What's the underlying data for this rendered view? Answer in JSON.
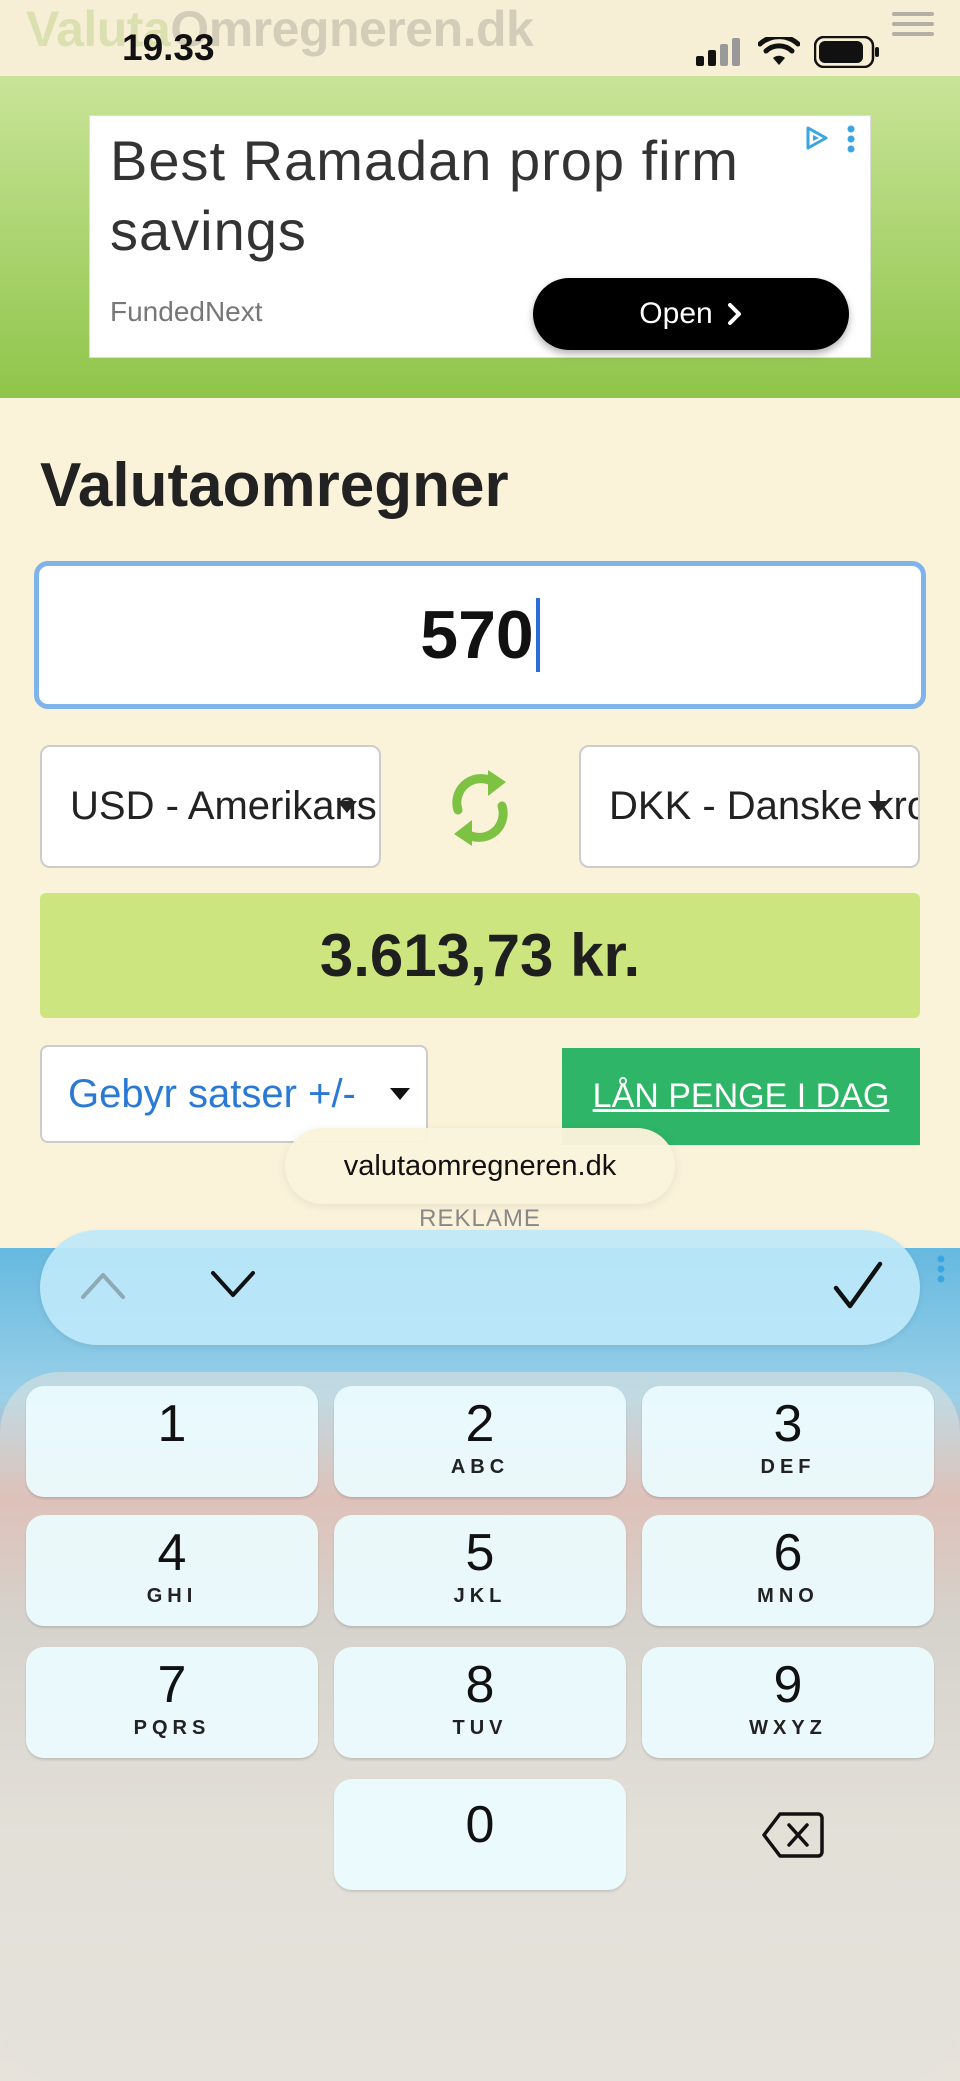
{
  "site": {
    "logo_part1": "Valuta",
    "logo_part2": "Omregneren.dk"
  },
  "status_bar": {
    "time": "19.33",
    "icons": [
      "signal-icon",
      "wifi-icon",
      "battery-icon"
    ]
  },
  "top_ad": {
    "headline": "Best Ramadan prop firm savings",
    "brand": "FundedNext",
    "cta_label": "Open"
  },
  "converter": {
    "title": "Valutaomregner",
    "amount": "570",
    "from_currency": "USD - Amerikansk dollar",
    "to_currency": "DKK - Danske kroner",
    "result": "3.613,73 kr.",
    "fee_select": "Gebyr satser +/-",
    "loan_button": "LÅN PENGE I DAG"
  },
  "browser": {
    "url": "valutaomregneren.dk"
  },
  "ad_label": "REKLAME",
  "keyboard": {
    "keys": [
      {
        "digit": "1",
        "letters": ""
      },
      {
        "digit": "2",
        "letters": "ABC"
      },
      {
        "digit": "3",
        "letters": "DEF"
      },
      {
        "digit": "4",
        "letters": "GHI"
      },
      {
        "digit": "5",
        "letters": "JKL"
      },
      {
        "digit": "6",
        "letters": "MNO"
      },
      {
        "digit": "7",
        "letters": "PQRS"
      },
      {
        "digit": "8",
        "letters": "TUV"
      },
      {
        "digit": "9",
        "letters": "WXYZ"
      },
      {
        "digit": "0",
        "letters": ""
      }
    ]
  },
  "colors": {
    "accent_green": "#8fc54a",
    "result_bg": "#cde57e",
    "loan_button_bg": "#2fb567",
    "input_focus": "#7fb3ec"
  }
}
